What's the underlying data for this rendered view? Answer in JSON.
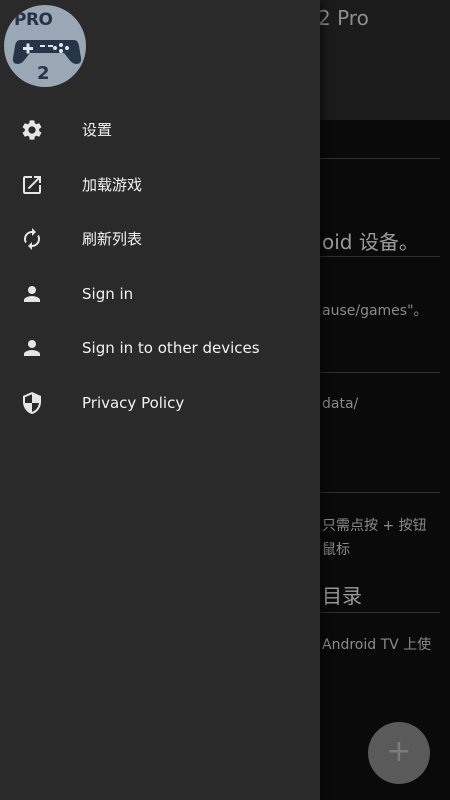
{
  "background": {
    "title": "2 Pro",
    "heading": "oid 设备。",
    "path_text": "ause/games\"。",
    "data_text": "data/",
    "hint_line1": "只需点按 + 按钮",
    "hint_line2": "鼠标",
    "section_heading": "目录",
    "tv_text": "Android TV 上使",
    "fab_label": "+"
  },
  "drawer": {
    "logo": {
      "top_text": "PRO",
      "bottom_text": "2"
    },
    "items": [
      {
        "label": "设置",
        "icon": "gear-icon"
      },
      {
        "label": "加载游戏",
        "icon": "open-in-new-icon"
      },
      {
        "label": "刷新列表",
        "icon": "refresh-icon"
      },
      {
        "label": "Sign in",
        "icon": "person-icon"
      },
      {
        "label": "Sign in to other devices",
        "icon": "person-icon"
      },
      {
        "label": "Privacy Policy",
        "icon": "shield-icon"
      }
    ]
  },
  "colors": {
    "drawer_bg": "#2a2a2a",
    "icon": "#e6e6e6",
    "text": "#f2f2f2",
    "logo_bg": "#9aa7b4"
  }
}
